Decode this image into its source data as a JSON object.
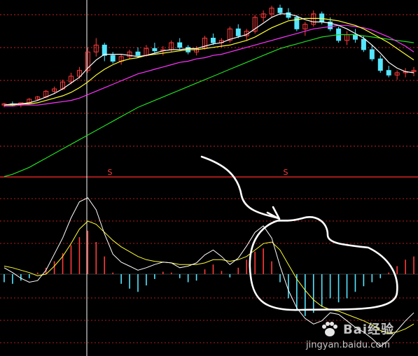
{
  "chart_data": [
    {
      "type": "candlestick",
      "panel": "price",
      "title": "",
      "note": "",
      "colors": {
        "up": "#ff3b3b",
        "down": "#55e6ff",
        "ma5": "#ffffff",
        "ma10": "#ffff33",
        "ma20": "#ff33ff",
        "ma60": "#22dd22",
        "grid": "#ff2a2a"
      },
      "ylim": [
        0,
        100
      ],
      "candles": [
        [
          12,
          14,
          10,
          13
        ],
        [
          13,
          15,
          11,
          12
        ],
        [
          12,
          14,
          10,
          14
        ],
        [
          14,
          18,
          13,
          17
        ],
        [
          17,
          20,
          16,
          19
        ],
        [
          19,
          25,
          18,
          24
        ],
        [
          24,
          28,
          22,
          26
        ],
        [
          26,
          34,
          25,
          32
        ],
        [
          32,
          40,
          30,
          37
        ],
        [
          37,
          45,
          35,
          42
        ],
        [
          42,
          62,
          40,
          58
        ],
        [
          58,
          70,
          54,
          64
        ],
        [
          64,
          66,
          50,
          55
        ],
        [
          55,
          58,
          48,
          50
        ],
        [
          50,
          56,
          47,
          54
        ],
        [
          54,
          60,
          52,
          58
        ],
        [
          58,
          62,
          53,
          55
        ],
        [
          55,
          64,
          54,
          61
        ],
        [
          61,
          66,
          57,
          59
        ],
        [
          59,
          63,
          55,
          60
        ],
        [
          60,
          68,
          58,
          66
        ],
        [
          66,
          70,
          60,
          62
        ],
        [
          62,
          64,
          56,
          58
        ],
        [
          58,
          63,
          55,
          61
        ],
        [
          61,
          72,
          60,
          70
        ],
        [
          70,
          74,
          64,
          66
        ],
        [
          66,
          70,
          62,
          68
        ],
        [
          68,
          80,
          66,
          78
        ],
        [
          78,
          82,
          70,
          72
        ],
        [
          72,
          78,
          68,
          76
        ],
        [
          76,
          90,
          74,
          88
        ],
        [
          88,
          94,
          84,
          91
        ],
        [
          91,
          98,
          88,
          96
        ],
        [
          96,
          99,
          90,
          92
        ],
        [
          92,
          96,
          86,
          88
        ],
        [
          88,
          90,
          76,
          78
        ],
        [
          78,
          84,
          72,
          82
        ],
        [
          82,
          94,
          80,
          91
        ],
        [
          91,
          93,
          82,
          84
        ],
        [
          84,
          88,
          76,
          78
        ],
        [
          78,
          80,
          66,
          68
        ],
        [
          68,
          76,
          64,
          73
        ],
        [
          73,
          78,
          66,
          69
        ],
        [
          69,
          72,
          58,
          60
        ],
        [
          60,
          64,
          50,
          52
        ],
        [
          52,
          55,
          40,
          42
        ],
        [
          42,
          46,
          36,
          38
        ],
        [
          38,
          42,
          34,
          40
        ],
        [
          40,
          44,
          36,
          41
        ],
        [
          41,
          45,
          37,
          42
        ]
      ],
      "ma5": [
        12,
        13,
        13,
        14,
        16,
        19,
        22,
        26,
        31,
        36,
        44,
        51,
        56,
        56,
        56,
        55,
        54,
        55,
        57,
        59,
        60,
        60,
        61,
        61,
        63,
        65,
        66,
        69,
        71,
        73,
        78,
        83,
        88,
        91,
        91,
        89,
        86,
        84,
        84,
        83,
        81,
        78,
        74,
        70,
        64,
        57,
        49,
        44,
        41,
        40
      ],
      "ma10": [
        12,
        12,
        13,
        13,
        14,
        16,
        18,
        20,
        23,
        27,
        32,
        38,
        43,
        47,
        50,
        52,
        53,
        55,
        56,
        57,
        58,
        59,
        60,
        60,
        61,
        62,
        63,
        64,
        66,
        68,
        71,
        75,
        79,
        82,
        85,
        86,
        87,
        87,
        87,
        86,
        85,
        83,
        81,
        78,
        74,
        70,
        66,
        61,
        56,
        51
      ],
      "ma20": [
        11,
        11,
        12,
        12,
        12,
        13,
        14,
        15,
        16,
        18,
        21,
        24,
        27,
        30,
        33,
        36,
        39,
        41,
        43,
        45,
        47,
        49,
        50,
        52,
        53,
        55,
        56,
        58,
        60,
        62,
        64,
        66,
        68,
        70,
        72,
        74,
        76,
        78,
        79,
        80,
        81,
        81,
        80,
        79,
        77,
        74,
        71,
        67,
        63,
        58
      ],
      "ma60": [
        -50,
        -48,
        -45,
        -42,
        -38,
        -34,
        -30,
        -26,
        -22,
        -18,
        -14,
        -10,
        -6,
        -2,
        2,
        6,
        10,
        13,
        16,
        19,
        22,
        25,
        28,
        31,
        34,
        37,
        40,
        43,
        46,
        49,
        52,
        55,
        58,
        61,
        63,
        65,
        67,
        69,
        71,
        72,
        73,
        73,
        73,
        72,
        71,
        70,
        69,
        68,
        67,
        66
      ]
    },
    {
      "type": "macd",
      "panel": "indicator",
      "title": "",
      "xlabel": "",
      "ylabel": "",
      "colors": {
        "positive": "#ff3b3b",
        "negative": "#55e6ff",
        "dif": "#ffffff",
        "dea": "#ffff33",
        "zero": "#ffffff"
      },
      "ylim": [
        -1,
        1
      ],
      "hist": [
        -0.1,
        -0.12,
        -0.08,
        -0.05,
        0.02,
        0.08,
        0.16,
        0.26,
        0.36,
        0.46,
        0.54,
        0.4,
        0.22,
        0.02,
        -0.12,
        -0.18,
        -0.22,
        -0.14,
        -0.06,
        0.03,
        0.02,
        -0.05,
        -0.1,
        -0.08,
        0.06,
        0.12,
        0.04,
        -0.04,
        0.08,
        0.18,
        0.28,
        0.32,
        0.16,
        -0.1,
        -0.3,
        -0.45,
        -0.52,
        -0.48,
        -0.4,
        -0.3,
        -0.35,
        -0.3,
        -0.22,
        -0.15,
        -0.1,
        -0.05,
        0.02,
        0.1,
        0.18,
        0.22
      ],
      "dif": [
        0.08,
        0.02,
        -0.05,
        -0.1,
        -0.08,
        0.05,
        0.25,
        0.45,
        0.7,
        0.9,
        0.95,
        0.8,
        0.5,
        0.25,
        0.15,
        0.1,
        0.05,
        0.08,
        0.12,
        0.15,
        0.14,
        0.08,
        0.1,
        0.14,
        0.24,
        0.3,
        0.22,
        0.12,
        0.2,
        0.35,
        0.52,
        0.6,
        0.45,
        0.1,
        -0.2,
        -0.42,
        -0.55,
        -0.62,
        -0.58,
        -0.48,
        -0.5,
        -0.58,
        -0.66,
        -0.72,
        -0.8,
        -0.9,
        -0.82,
        -0.7,
        -0.58,
        -0.48
      ],
      "dea": [
        0.1,
        0.08,
        0.05,
        0.02,
        -0.02,
        0.0,
        0.1,
        0.22,
        0.38,
        0.56,
        0.66,
        0.62,
        0.52,
        0.42,
        0.34,
        0.28,
        0.22,
        0.18,
        0.16,
        0.15,
        0.14,
        0.12,
        0.12,
        0.12,
        0.14,
        0.18,
        0.18,
        0.16,
        0.18,
        0.22,
        0.3,
        0.38,
        0.4,
        0.3,
        0.12,
        -0.06,
        -0.2,
        -0.32,
        -0.4,
        -0.44,
        -0.46,
        -0.5,
        -0.54,
        -0.58,
        -0.63,
        -0.7,
        -0.73,
        -0.72,
        -0.68,
        -0.62
      ]
    }
  ],
  "watermark": {
    "brand": "Bai经验",
    "url": "jingyan.baidu.com"
  },
  "markers": {
    "signal": "S"
  }
}
